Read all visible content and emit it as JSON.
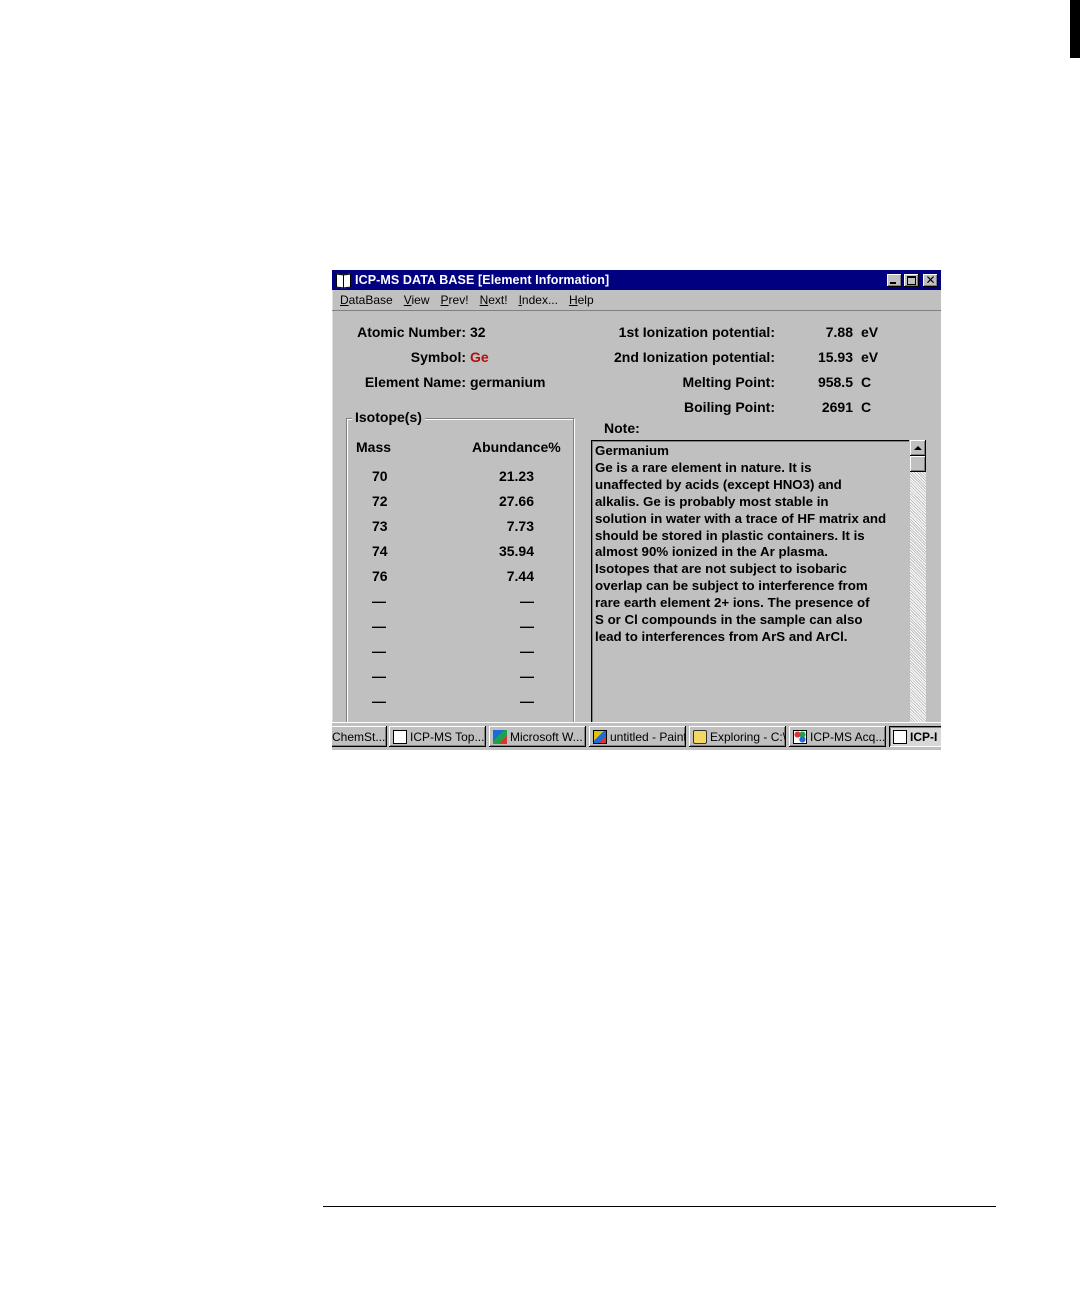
{
  "window": {
    "title": "ICP-MS DATA BASE [Element Information]"
  },
  "menu": [
    {
      "first": "D",
      "rest": "ataBase"
    },
    {
      "first": "V",
      "rest": "iew"
    },
    {
      "first": "P",
      "rest": "rev!"
    },
    {
      "first": "N",
      "rest": "ext!"
    },
    {
      "first": "I",
      "rest": "ndex..."
    },
    {
      "first": "H",
      "rest": "elp"
    }
  ],
  "element": {
    "atomic_number_label": "Atomic Number:",
    "atomic_number": "32",
    "symbol_label": "Symbol:",
    "symbol": "Ge",
    "name_label": "Element Name:",
    "name": "germanium"
  },
  "properties": [
    {
      "label": "1st Ionization potential:",
      "value": "7.88",
      "unit": "eV"
    },
    {
      "label": "2nd Ionization potential:",
      "value": "15.93",
      "unit": "eV"
    },
    {
      "label": "Melting Point:",
      "value": "958.5",
      "unit": "C"
    },
    {
      "label": "Boiling Point:",
      "value": "2691",
      "unit": "C"
    }
  ],
  "isotopes": {
    "group_title": "Isotope(s)",
    "mass_header": "Mass",
    "abundance_header": "Abundance%",
    "rows": [
      {
        "mass": "70",
        "abundance": "21.23"
      },
      {
        "mass": "72",
        "abundance": "27.66"
      },
      {
        "mass": "73",
        "abundance": "7.73"
      },
      {
        "mass": "74",
        "abundance": "35.94"
      },
      {
        "mass": "76",
        "abundance": "7.44"
      },
      {
        "mass": "—",
        "abundance": "—"
      },
      {
        "mass": "—",
        "abundance": "—"
      },
      {
        "mass": "—",
        "abundance": "—"
      },
      {
        "mass": "—",
        "abundance": "—"
      },
      {
        "mass": "—",
        "abundance": "—"
      }
    ]
  },
  "note": {
    "label": "Note:",
    "lines": [
      "Germanium",
      "Ge is a rare element in nature.  It is",
      "unaffected by acids (except HNO3) and",
      "alkalis.  Ge is probably most stable in",
      "solution in water with a trace of HF matrix and",
      "should be stored in plastic containers.  It is",
      "almost 90% ionized in the Ar plasma.",
      "Isotopes that are not subject to isobaric",
      "overlap can be subject to interference from",
      "rare earth element 2+ ions.  The presence of",
      "S or Cl compounds in the sample can also",
      "lead to interferences from ArS and ArCl."
    ]
  },
  "taskbar": [
    {
      "label": "ChemSt...",
      "icon": "none"
    },
    {
      "label": "ICP-MS Top...",
      "icon": "document-icon"
    },
    {
      "label": "Microsoft W...",
      "icon": "word-icon"
    },
    {
      "label": "untitled - Paint",
      "icon": "paint-icon"
    },
    {
      "label": "Exploring - C:\\",
      "icon": "explorer-icon"
    },
    {
      "label": "ICP-MS Acq...",
      "icon": "acquisition-icon"
    },
    {
      "label": "ICP-I",
      "icon": "book-icon",
      "active": true
    }
  ]
}
